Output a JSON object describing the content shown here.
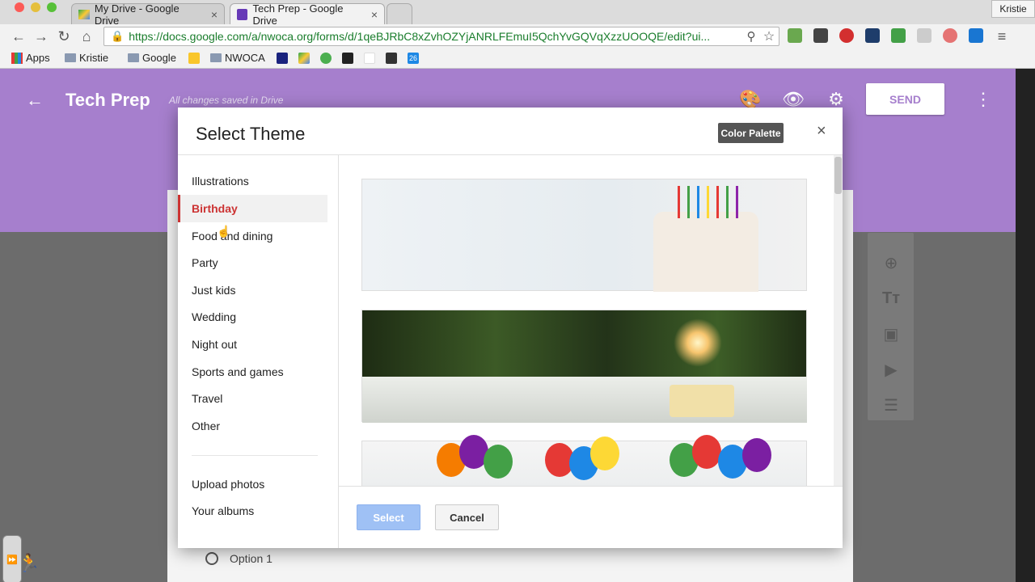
{
  "browser": {
    "tabs": [
      {
        "label": "My Drive - Google Drive",
        "active": false
      },
      {
        "label": "Tech Prep - Google Drive",
        "active": true
      }
    ],
    "profile": "Kristie",
    "url": "https://docs.google.com/a/nwoca.org/forms/d/1qeBJRbC8xZvhOZYjANRLFEmuI5QchYvGQVqXzzUOOQE/edit?ui...",
    "bookmarks": [
      "Apps",
      "Kristie",
      "Google",
      "NWOCA"
    ],
    "calendar_badge": "26"
  },
  "header": {
    "back_icon": "arrow-left-icon",
    "title": "Tech Prep",
    "saved_status": "All changes saved in Drive",
    "send_label": "SEND"
  },
  "dialog": {
    "title": "Select Theme",
    "palette_label": "Color Palette",
    "close_symbol": "×",
    "categories": [
      "Illustrations",
      "Birthday",
      "Food and dining",
      "Party",
      "Just kids",
      "Wedding",
      "Night out",
      "Sports and games",
      "Travel",
      "Other"
    ],
    "active_category": "Birthday",
    "extra_links": [
      "Upload photos",
      "Your albums"
    ],
    "select_label": "Select",
    "cancel_label": "Cancel"
  },
  "form": {
    "option_label": "Option 1"
  },
  "colors": {
    "header_purple": "#a67fcd",
    "active_red": "#cc3333",
    "select_blue": "#9fc1f5"
  }
}
